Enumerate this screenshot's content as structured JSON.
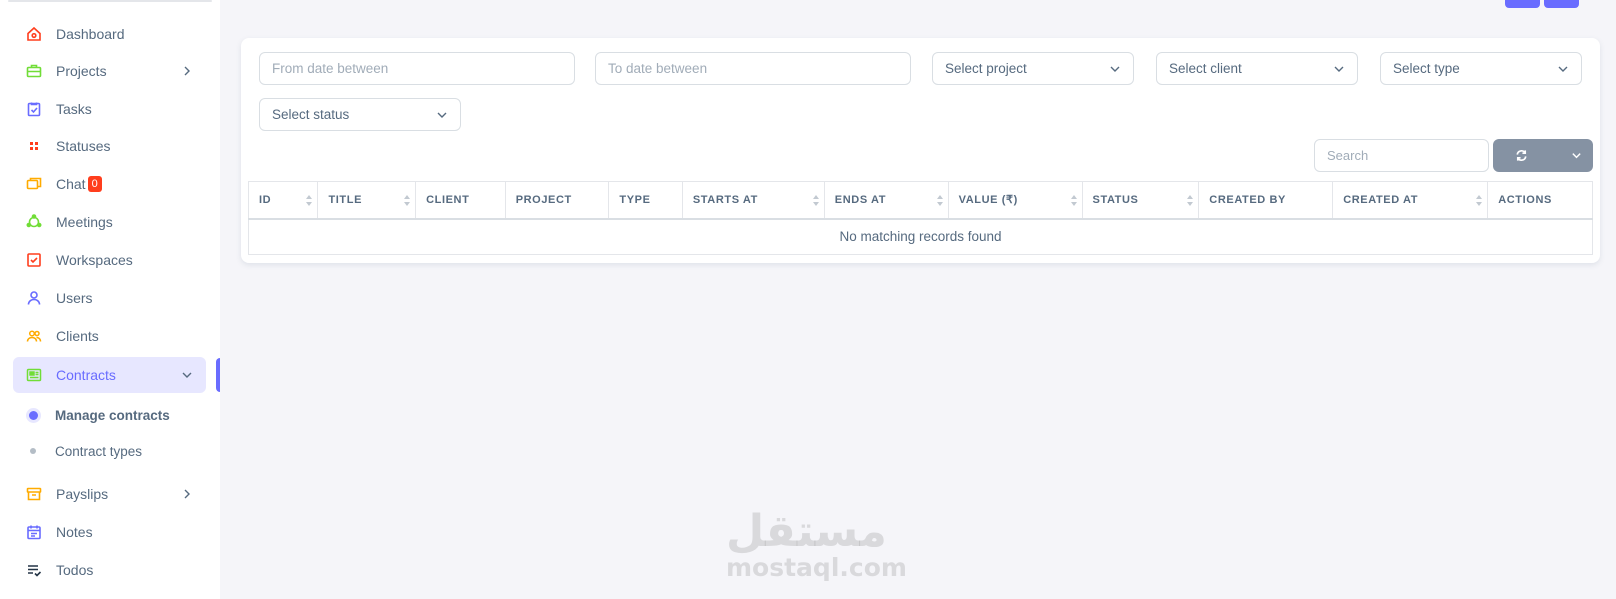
{
  "sidebar": {
    "items": [
      {
        "label": "Dashboard",
        "icon": "home-icon",
        "color": "#ff3e1d"
      },
      {
        "label": "Projects",
        "icon": "briefcase-icon",
        "color": "#71dd37",
        "has_submenu": true
      },
      {
        "label": "Tasks",
        "icon": "clipboard-check-icon",
        "color": "#696cff"
      },
      {
        "label": "Statuses",
        "icon": "grid-dots-icon",
        "color": "#ff3e1d"
      },
      {
        "label": "Chat",
        "icon": "chat-icon",
        "color": "#ffab00",
        "badge": "0"
      },
      {
        "label": "Meetings",
        "icon": "network-icon",
        "color": "#71dd37"
      },
      {
        "label": "Workspaces",
        "icon": "check-square-icon",
        "color": "#ff3e1d"
      },
      {
        "label": "Users",
        "icon": "user-icon",
        "color": "#696cff"
      },
      {
        "label": "Clients",
        "icon": "group-icon",
        "color": "#ffab00"
      },
      {
        "label": "Contracts",
        "icon": "news-icon",
        "color": "#71dd37",
        "active": true,
        "expanded": true
      },
      {
        "label": "Payslips",
        "icon": "box-icon",
        "color": "#ffab00",
        "has_submenu": true
      },
      {
        "label": "Notes",
        "icon": "calendar-note-icon",
        "color": "#696cff"
      },
      {
        "label": "Todos",
        "icon": "list-check-icon",
        "color": "#233446"
      }
    ],
    "contracts_submenu": [
      {
        "label": "Manage contracts",
        "current": true
      },
      {
        "label": "Contract types",
        "current": false
      }
    ]
  },
  "filters": {
    "from_date_placeholder": "From date between",
    "to_date_placeholder": "To date between",
    "project_select": "Select project",
    "client_select": "Select client",
    "type_select": "Select type",
    "status_select": "Select status"
  },
  "toolbar": {
    "search_placeholder": "Search",
    "refresh_icon": "refresh-icon"
  },
  "table": {
    "columns": [
      "ID",
      "TITLE",
      "CLIENT",
      "PROJECT",
      "TYPE",
      "STARTS AT",
      "ENDS AT",
      "VALUE (₹)",
      "STATUS",
      "CREATED BY",
      "CREATED AT",
      "ACTIONS"
    ],
    "sortable": [
      true,
      true,
      false,
      false,
      false,
      true,
      true,
      true,
      true,
      false,
      true,
      false
    ],
    "empty_message": "No matching records found"
  },
  "watermark": {
    "arabic": "مستقل",
    "latin": "mostaql.com"
  },
  "colors": {
    "primary": "#696cff",
    "secondary": "#8592a3",
    "danger": "#ff3e1d",
    "active_bg": "#e7e7ff"
  }
}
